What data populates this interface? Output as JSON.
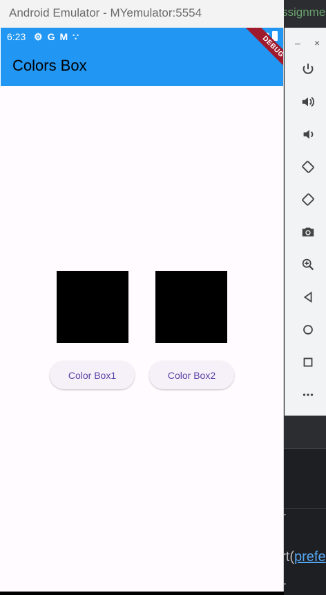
{
  "ide": {
    "tab_fragment": "ssignme",
    "code_text": "art(",
    "code_link": "prefe",
    "dot_mark": "."
  },
  "window": {
    "title": "Android Emulator - MYemulator:5554",
    "min_symbol": "–",
    "close_symbol": "×"
  },
  "status_bar": {
    "time": "6:23",
    "icons": [
      "gear-icon",
      "google-icon",
      "gmail-icon",
      "assistant-icon"
    ],
    "glyphs": [
      "⚙",
      "G",
      "M",
      "∵"
    ]
  },
  "app": {
    "title": "Colors Box",
    "debug_label": "DEBUG",
    "theme_color": "#2196f3",
    "boxes": [
      {
        "name": "color-box-1",
        "color": "#000000"
      },
      {
        "name": "color-box-2",
        "color": "#000000"
      }
    ],
    "buttons": [
      {
        "label": "Color Box1"
      },
      {
        "label": "Color Box2"
      }
    ]
  },
  "toolbar": {
    "tools": [
      "power-icon",
      "volume-up-icon",
      "volume-down-icon",
      "rotate-left-icon",
      "rotate-right-icon",
      "camera-icon",
      "zoom-icon",
      "back-icon",
      "home-icon",
      "overview-icon",
      "more-icon"
    ]
  }
}
